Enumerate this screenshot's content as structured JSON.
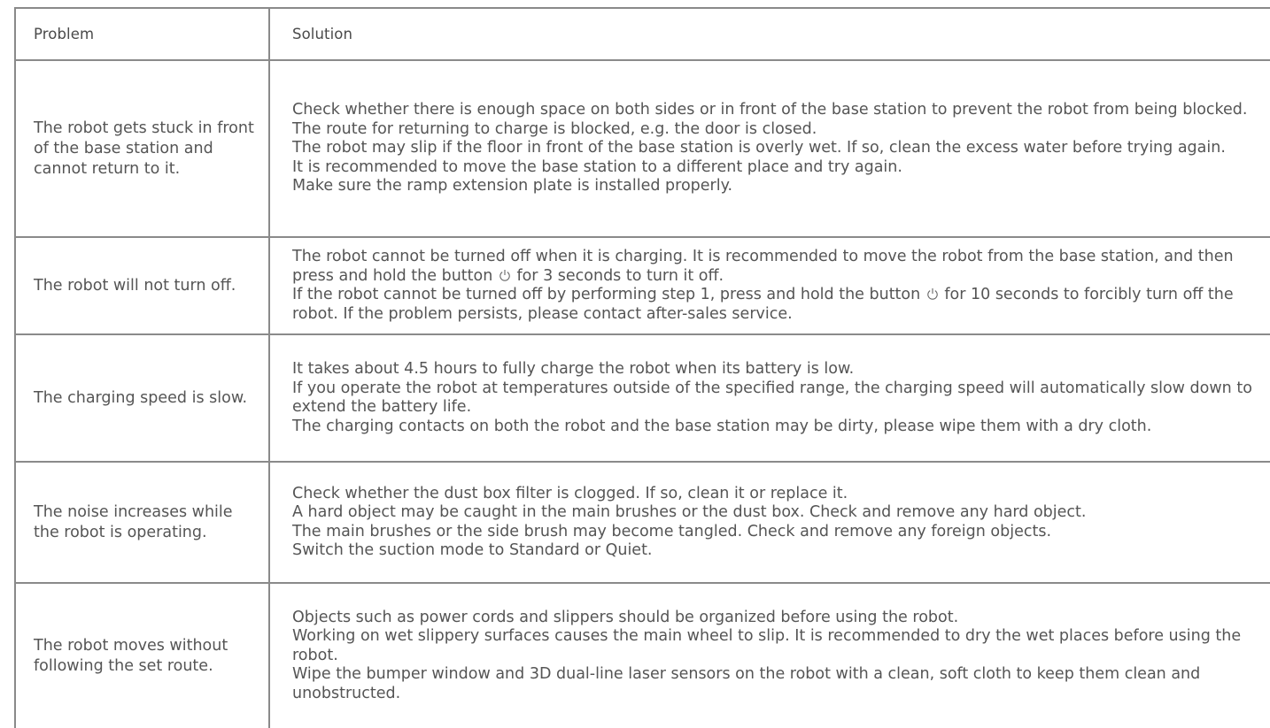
{
  "header": {
    "problem_label": "Problem",
    "solution_label": "Solution"
  },
  "rows": [
    {
      "problem": "The robot gets stuck in front of the base station and cannot return to it.",
      "solutions": [
        "Check whether there is enough space on both sides or in front of the base station to prevent the robot from being blocked.",
        "The route for returning to charge is blocked, e.g. the door is closed.",
        "The robot may slip if the floor in front of the base station is overly wet. If so, clean the excess water before trying again.",
        "It is recommended to move the base station to a different place and try again.",
        "Make sure the ramp extension plate is installed properly."
      ]
    },
    {
      "problem": "The robot will not turn off.",
      "solutions_rich": [
        {
          "before": "The robot cannot be turned off when it is charging. It is recommended to move the robot from the base station, and then press and hold the button ",
          "icon": "power-icon",
          "after": " for 3 seconds to turn it off."
        },
        {
          "before": "If the robot cannot be turned off by performing step 1, press and hold the button ",
          "icon": "power-icon",
          "after": " for 10 seconds to forcibly turn off the robot. If the problem persists, please contact after-sales service."
        }
      ]
    },
    {
      "problem": "The charging speed is slow.",
      "solutions": [
        "It takes about 4.5 hours to fully charge the robot when its battery is low.",
        "If you operate the robot at temperatures outside of the specified range, the charging speed will automatically slow down to extend the battery life.",
        "The charging contacts on both the robot and the base station may be dirty, please wipe them with a dry cloth."
      ]
    },
    {
      "problem": "The noise increases while the robot is operating.",
      "solutions": [
        "Check whether the dust box filter is clogged. If so, clean it or replace it.",
        "A hard object may be caught in the main brushes or the dust box. Check and remove any hard object.",
        "The main brushes or the side brush may become tangled. Check and remove any foreign objects.",
        "Switch the suction mode to Standard or Quiet."
      ]
    },
    {
      "problem": "The robot moves without following the set route.",
      "solutions": [
        "Objects such as power cords and slippers should be organized before using the robot.",
        "Working on wet slippery surfaces causes the main wheel to slip. It is recommended to dry the wet places before using the robot.",
        "Wipe the bumper window and 3D dual-line laser sensors on the robot with a clean, soft cloth to keep them clean and unobstructed."
      ]
    }
  ]
}
